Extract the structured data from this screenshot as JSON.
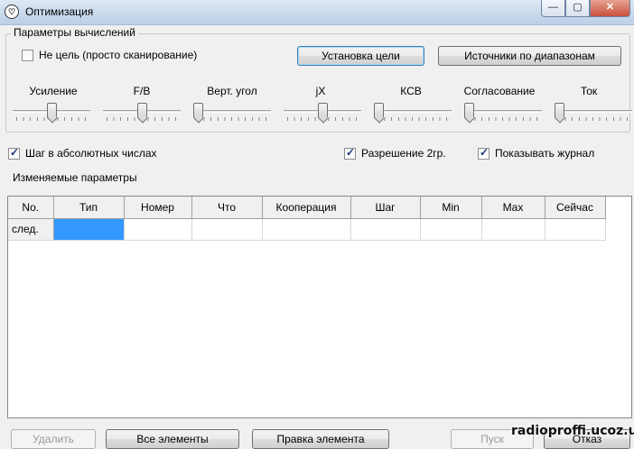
{
  "window": {
    "title": "Оптимизация",
    "controls": {
      "minimize": "—",
      "maximize": "▢",
      "close": "✕"
    }
  },
  "params_group": {
    "legend": "Параметры вычислений",
    "no_target": {
      "label": "Не цель (просто сканирование)",
      "checked": false
    },
    "set_target_button": "Установка цели",
    "range_sources_button": "Источники по диапазонам",
    "sliders": [
      {
        "label": "Усиление",
        "level": 0.5
      },
      {
        "label": "F/B",
        "level": 0.5
      },
      {
        "label": "Верт. угол",
        "level": 0.0
      },
      {
        "label": "jX",
        "level": 0.5
      },
      {
        "label": "КСВ",
        "level": 0.0
      },
      {
        "label": "Согласование",
        "level": 0.0
      },
      {
        "label": "Ток",
        "level": 0.0
      }
    ]
  },
  "options": {
    "abs_step": {
      "label": "Шаг в абсолютных числах",
      "checked": true
    },
    "resolution_2gr": {
      "label": "Разрешение 2гр.",
      "checked": true
    },
    "show_log": {
      "label": "Показывать журнал",
      "checked": true
    }
  },
  "variable_params_label": "Изменяемые параметры",
  "table": {
    "columns": [
      "No.",
      "Тип",
      "Номер",
      "Что",
      "Кооперация",
      "Шаг",
      "Min",
      "Max",
      "Сейчас"
    ],
    "rows": [
      [
        "след.",
        "",
        "",
        "",
        "",
        "",
        "",
        "",
        ""
      ]
    ],
    "selected_color": "#3399ff"
  },
  "bottom_buttons": {
    "delete": "Удалить",
    "all_elements": "Все элементы",
    "edit_element": "Правка элемента",
    "start": "Пуск",
    "cancel": "Отказ"
  },
  "watermark": "radioproffi.ucoz.ua"
}
